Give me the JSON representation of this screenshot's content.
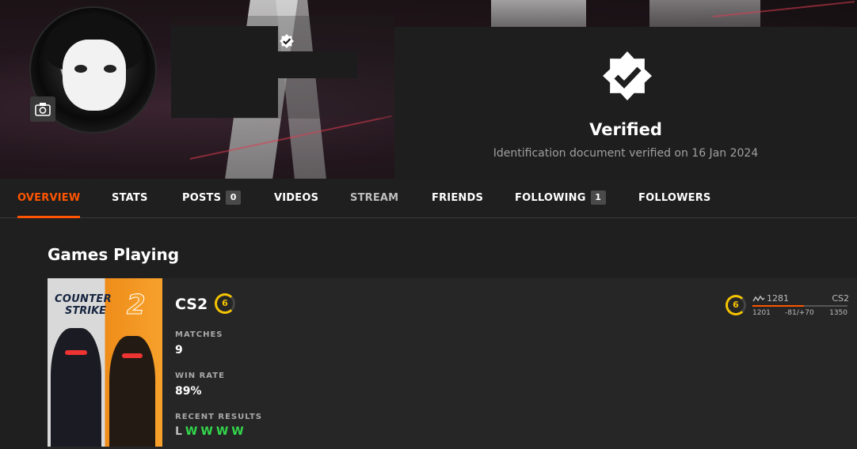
{
  "verification": {
    "title": "Verified",
    "subtitle": "Identification document verified on 16 Jan 2024"
  },
  "tabs": [
    {
      "label": "OVERVIEW",
      "active": true
    },
    {
      "label": "STATS"
    },
    {
      "label": "POSTS",
      "count": "0"
    },
    {
      "label": "VIDEOS"
    },
    {
      "label": "STREAM"
    },
    {
      "label": "FRIENDS"
    },
    {
      "label": "FOLLOWING",
      "count": "1"
    },
    {
      "label": "FOLLOWERS"
    }
  ],
  "games_section": {
    "title": "Games Playing",
    "game": {
      "name": "CS2",
      "cover_logo_line1": "COUNTER",
      "cover_logo_line2": "STRIKE",
      "cover_logo_number": "2",
      "level": "6",
      "matches_label": "MATCHES",
      "matches_value": "9",
      "win_rate_label": "WIN RATE",
      "win_rate_value": "89%",
      "recent_label": "RECENT RESULTS",
      "recent_results": [
        "L",
        "W",
        "W",
        "W",
        "W"
      ],
      "elo": {
        "level": "6",
        "current": "1281",
        "game": "CS2",
        "min": "1201",
        "delta": "-81/+70",
        "max": "1350",
        "progress": 0.54
      }
    }
  },
  "colors": {
    "accent": "#ff5500",
    "win": "#32d74b",
    "level": "#f5c400"
  }
}
